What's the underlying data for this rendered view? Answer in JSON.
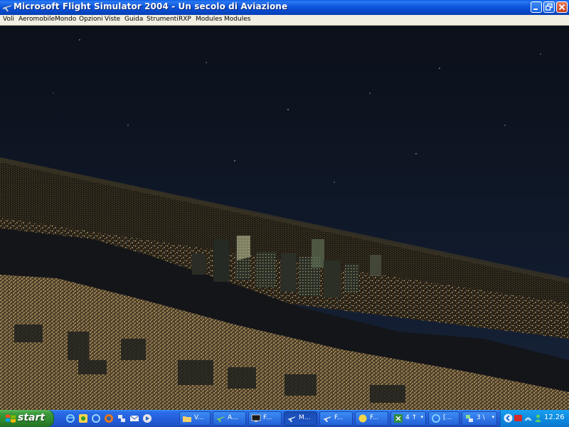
{
  "window": {
    "title": "Microsoft Flight Simulator 2004 - Un secolo di Aviazione",
    "titlebar_color": "#0a5ee8"
  },
  "menu": {
    "items": [
      "Voli",
      "Aeromobile",
      "Mondo",
      "Opzioni",
      "Viste",
      "Guida",
      "Strumenti",
      "RXP",
      "Modules",
      "Modules"
    ]
  },
  "scene": {
    "description_icon": "night-city-flight-view",
    "sky_color": "#0c1220"
  },
  "taskbar": {
    "start_label": "start",
    "quick_launch": [
      "ie-icon",
      "messenger-icon",
      "ie-icon-2",
      "firefox-icon",
      "network-icon",
      "outlook-icon",
      "media-icon"
    ],
    "tasks": [
      {
        "label": "V...",
        "icon": "folder-icon",
        "active": false,
        "arrow": ""
      },
      {
        "label": "A...",
        "icon": "plane-app-icon",
        "active": false,
        "arrow": ""
      },
      {
        "label": "F...",
        "icon": "monitor-icon",
        "active": false,
        "arrow": ""
      },
      {
        "label": "M...",
        "icon": "plane-app-icon",
        "active": true,
        "arrow": ""
      },
      {
        "label": "F...",
        "icon": "plane-app-icon",
        "active": false,
        "arrow": ""
      },
      {
        "label": "F...",
        "icon": "globe-icon",
        "active": false,
        "arrow": ""
      },
      {
        "label": "4 ↑",
        "icon": "spreadsheet-icon",
        "active": false,
        "arrow": "▾"
      },
      {
        "label": "[...",
        "icon": "ie-icon",
        "active": false,
        "arrow": ""
      },
      {
        "label": "3 \\",
        "icon": "network-icon",
        "active": false,
        "arrow": "▾"
      }
    ],
    "clock": "12.26"
  }
}
